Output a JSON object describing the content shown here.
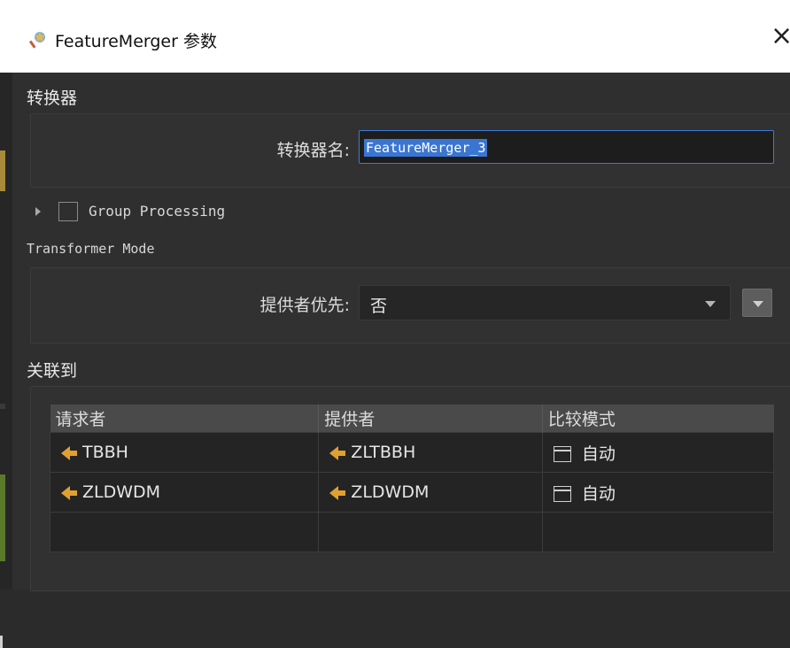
{
  "window": {
    "title": "FeatureMerger 参数",
    "close_glyph": "×",
    "icon": "transformer-wand-icon"
  },
  "transformer_section": {
    "heading": "转换器",
    "name_label": "转换器名:",
    "name_value": "FeatureMerger_3"
  },
  "group_processing": {
    "label": "Group Processing",
    "checked": false
  },
  "transformer_mode": {
    "heading": "Transformer Mode",
    "supplier_first_label": "提供者优先:",
    "supplier_first_value": "否"
  },
  "join_section": {
    "heading": "关联到",
    "columns": [
      "请求者",
      "提供者",
      "比较模式"
    ],
    "rows": [
      {
        "requestor": "TBBH",
        "supplier": "ZLTBBH",
        "mode": "自动"
      },
      {
        "requestor": "ZLDWDM",
        "supplier": "ZLDWDM",
        "mode": "自动"
      },
      {
        "requestor": "",
        "supplier": "",
        "mode": ""
      }
    ]
  },
  "colors": {
    "background": "#2f2f2f",
    "accent": "#3a76d1",
    "port": "#e0a030"
  }
}
